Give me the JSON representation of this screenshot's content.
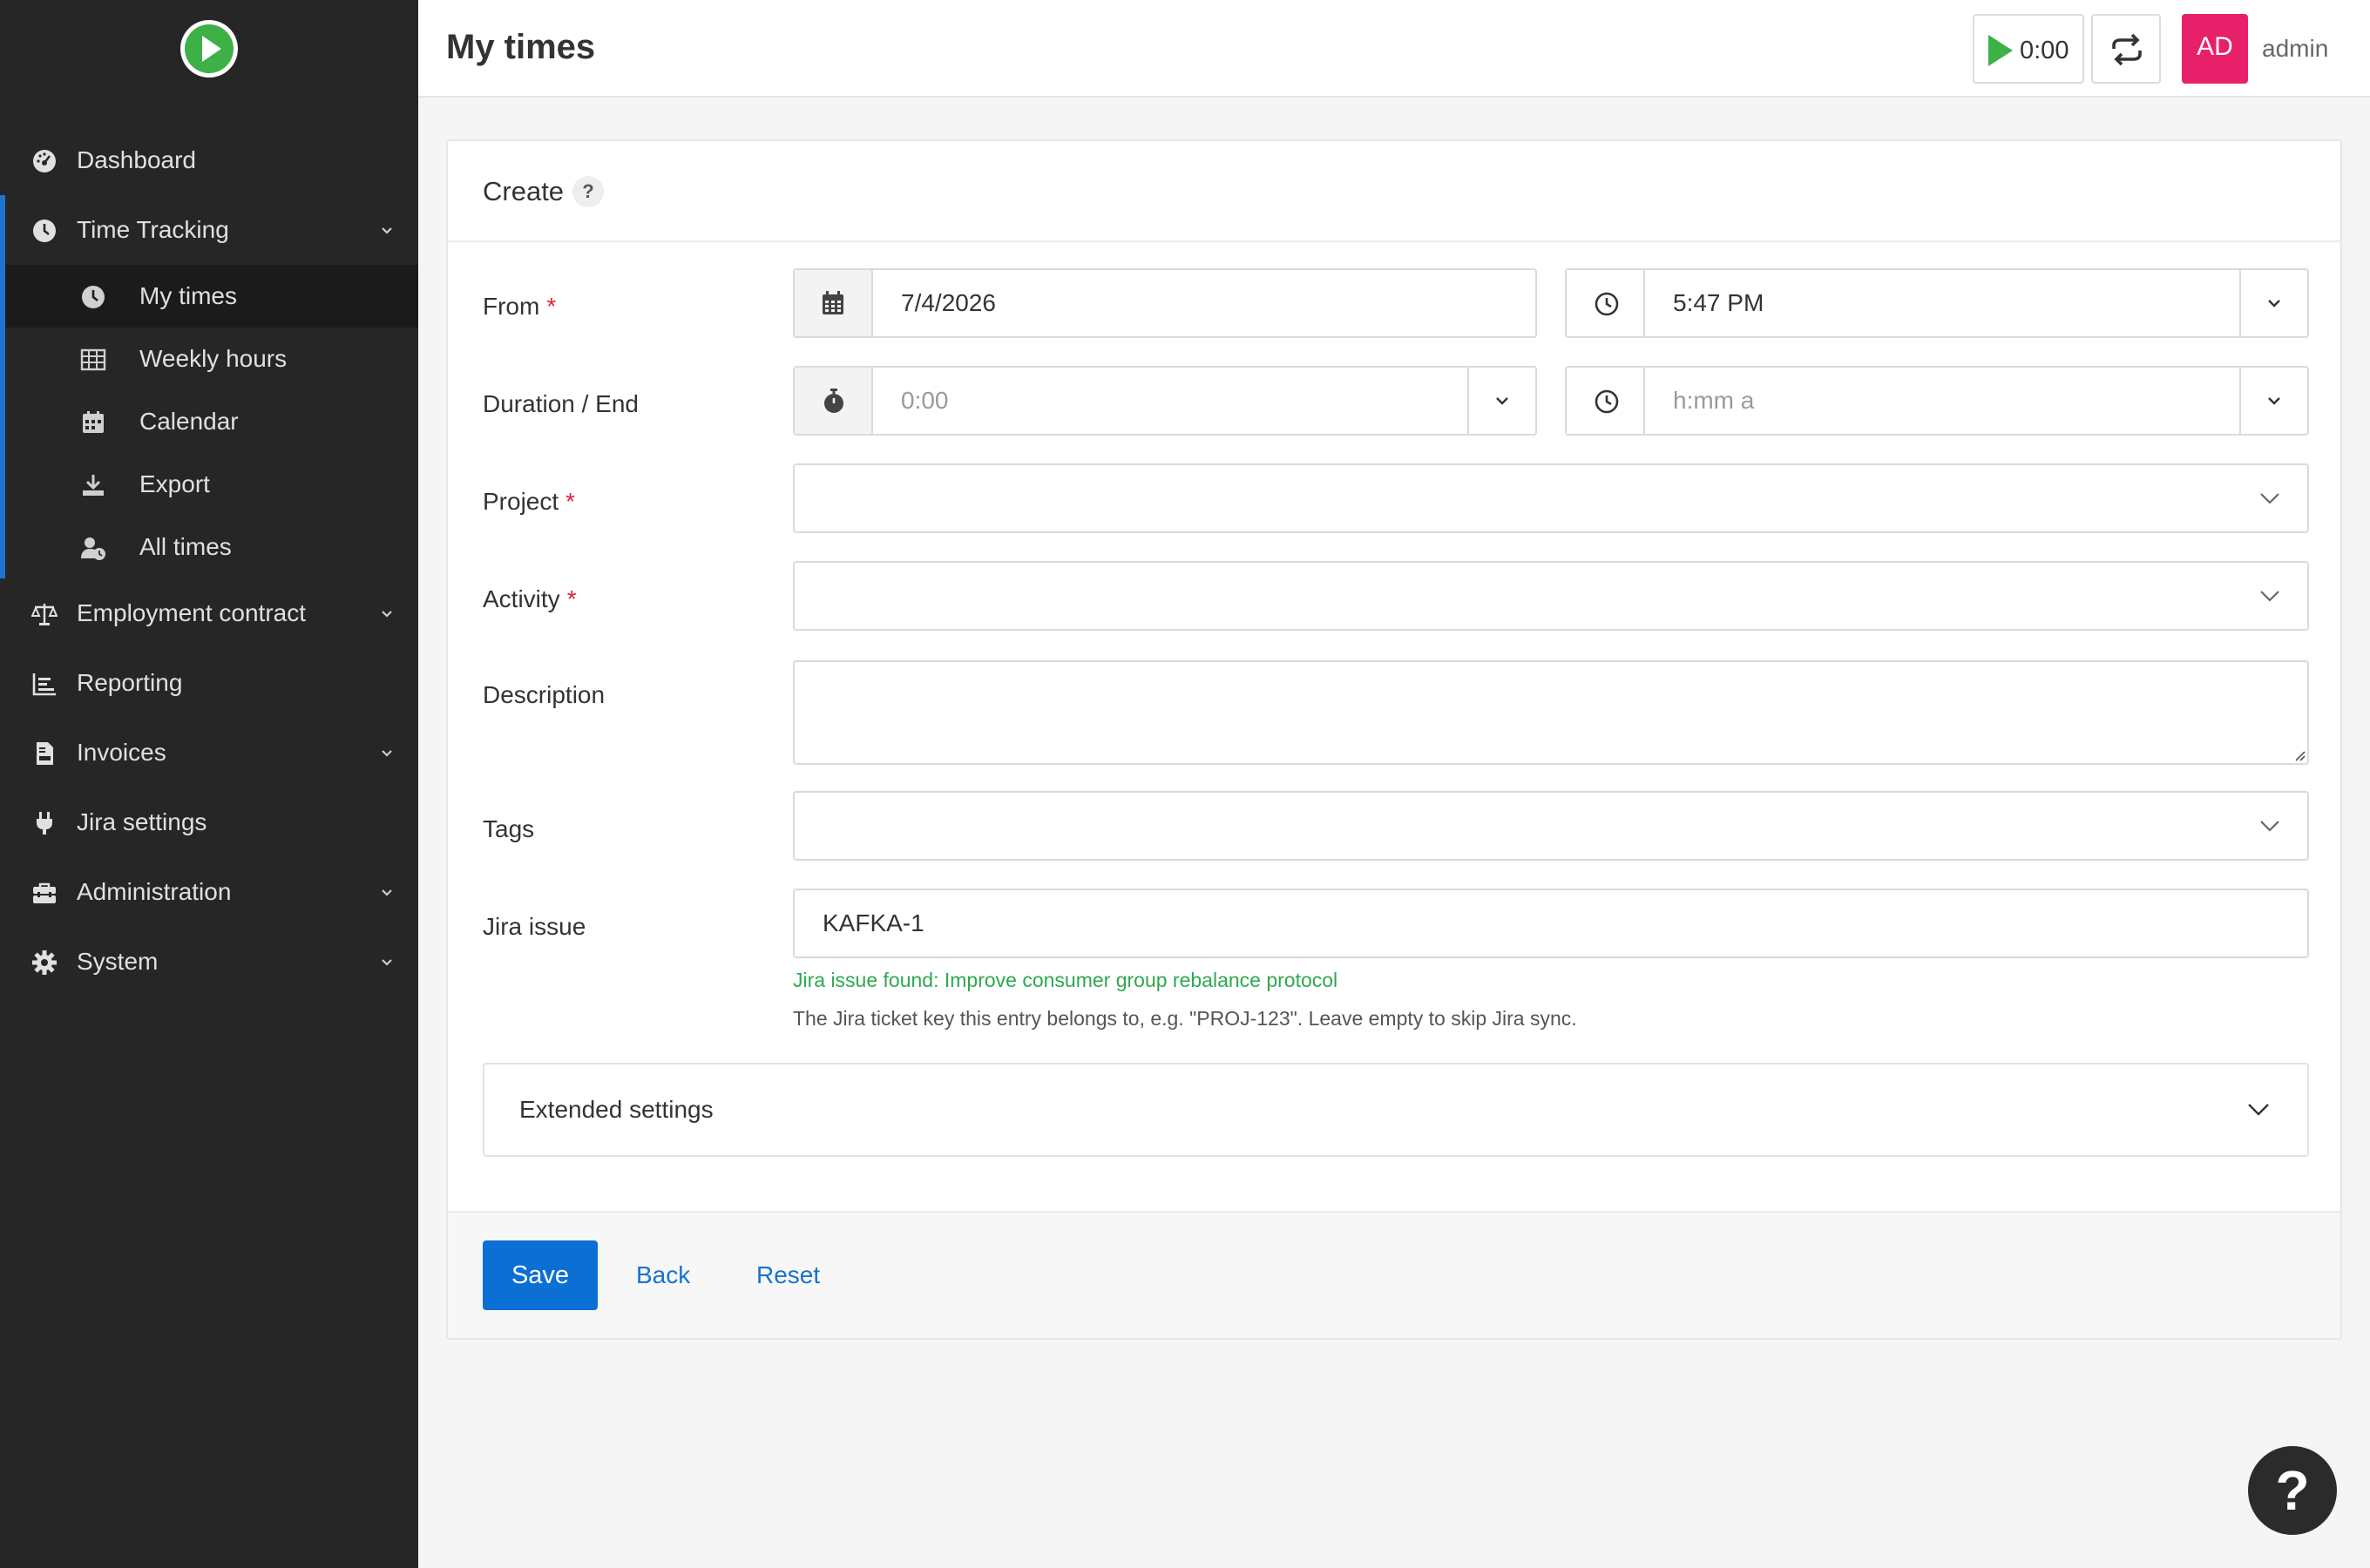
{
  "header": {
    "title": "My times",
    "timer_value": "0:00",
    "avatar_initials": "AD",
    "username": "admin"
  },
  "sidebar": {
    "items": [
      {
        "label": "Dashboard",
        "icon": "dashboard-icon"
      },
      {
        "label": "Time Tracking",
        "icon": "clock-icon"
      },
      {
        "label": "Employment contract",
        "icon": "scale-icon"
      },
      {
        "label": "Reporting",
        "icon": "chart-icon"
      },
      {
        "label": "Invoices",
        "icon": "invoice-icon"
      },
      {
        "label": "Jira settings",
        "icon": "plug-icon"
      },
      {
        "label": "Administration",
        "icon": "toolbox-icon"
      },
      {
        "label": "System",
        "icon": "gear-icon"
      }
    ],
    "subitems": [
      {
        "label": "My times",
        "icon": "clock-icon",
        "active": true
      },
      {
        "label": "Weekly hours",
        "icon": "grid-icon"
      },
      {
        "label": "Calendar",
        "icon": "calendar-icon"
      },
      {
        "label": "Export",
        "icon": "download-icon"
      },
      {
        "label": "All times",
        "icon": "users-clock-icon"
      }
    ]
  },
  "form": {
    "title": "Create",
    "help_badge": "?",
    "required_mark": "*",
    "from_label": "From",
    "from_date": "7/4/2026",
    "from_time": "5:47 PM",
    "duration_label": "Duration / End",
    "duration_placeholder": "0:00",
    "end_placeholder": "h:mm a",
    "project_label": "Project",
    "activity_label": "Activity",
    "description_label": "Description",
    "tags_label": "Tags",
    "jira_label": "Jira issue",
    "jira_value": "KAFKA-1",
    "jira_found": "Jira issue found: Improve consumer group rebalance protocol",
    "jira_help": "The Jira ticket key this entry belongs to, e.g. \"PROJ-123\". Leave empty to skip Jira sync.",
    "extended_label": "Extended settings",
    "save_label": "Save",
    "back_label": "Back",
    "reset_label": "Reset"
  },
  "help_fab": "?",
  "colors": {
    "accent": "#0b6fd4",
    "sidebar_bg": "#262626",
    "avatar": "#e8206a",
    "success": "#2fa84f",
    "required": "#d9243a"
  }
}
